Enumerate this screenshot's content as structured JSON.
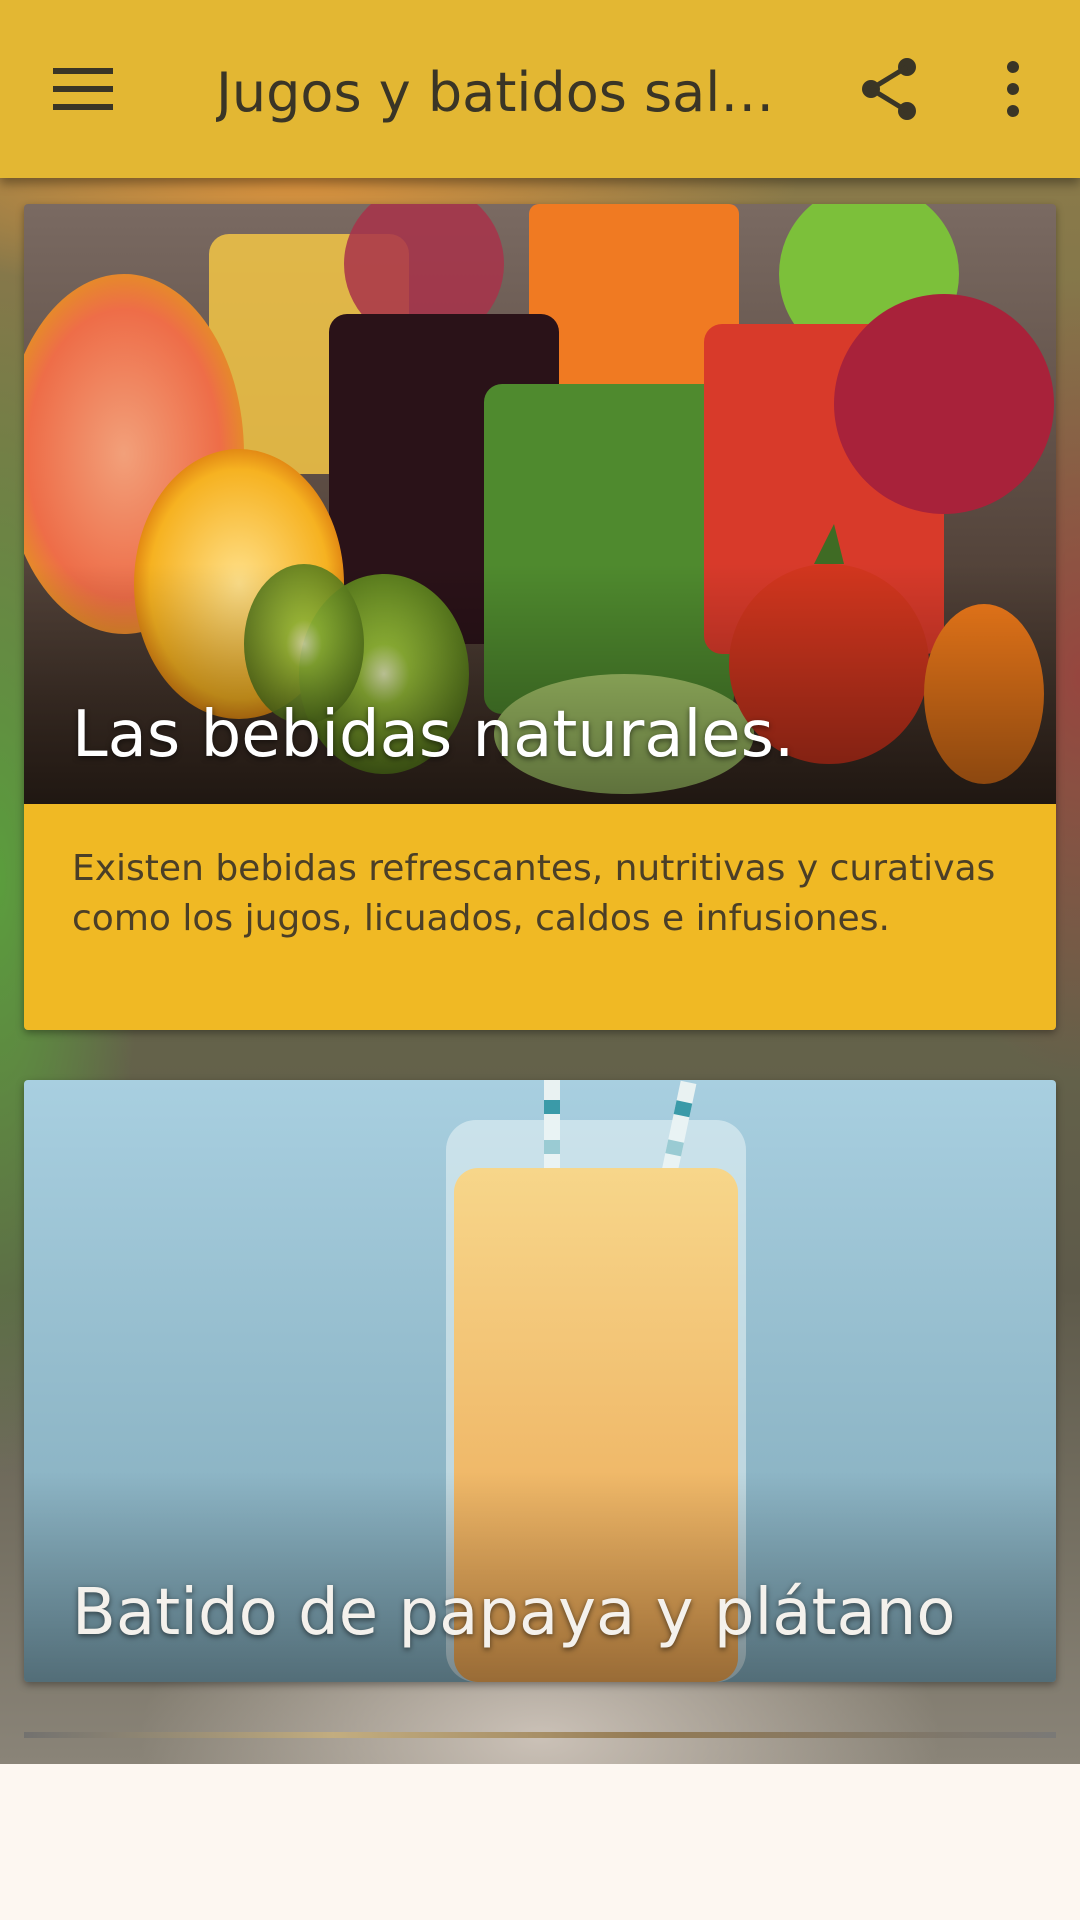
{
  "app_bar": {
    "title": "Jugos y batidos sal…",
    "icons": {
      "menu": "hamburger-menu-icon",
      "share": "share-icon",
      "more": "more-vertical-icon"
    },
    "background_color": "#e3b733"
  },
  "cards": [
    {
      "headline": "Las bebidas naturales.",
      "description": "Existen bebidas refrescantes, nutritivas y curativas como los jugos, licuados, caldos e infusiones.",
      "description_background": "#f0b924"
    },
    {
      "headline": "Batido de papaya y plátano"
    }
  ]
}
